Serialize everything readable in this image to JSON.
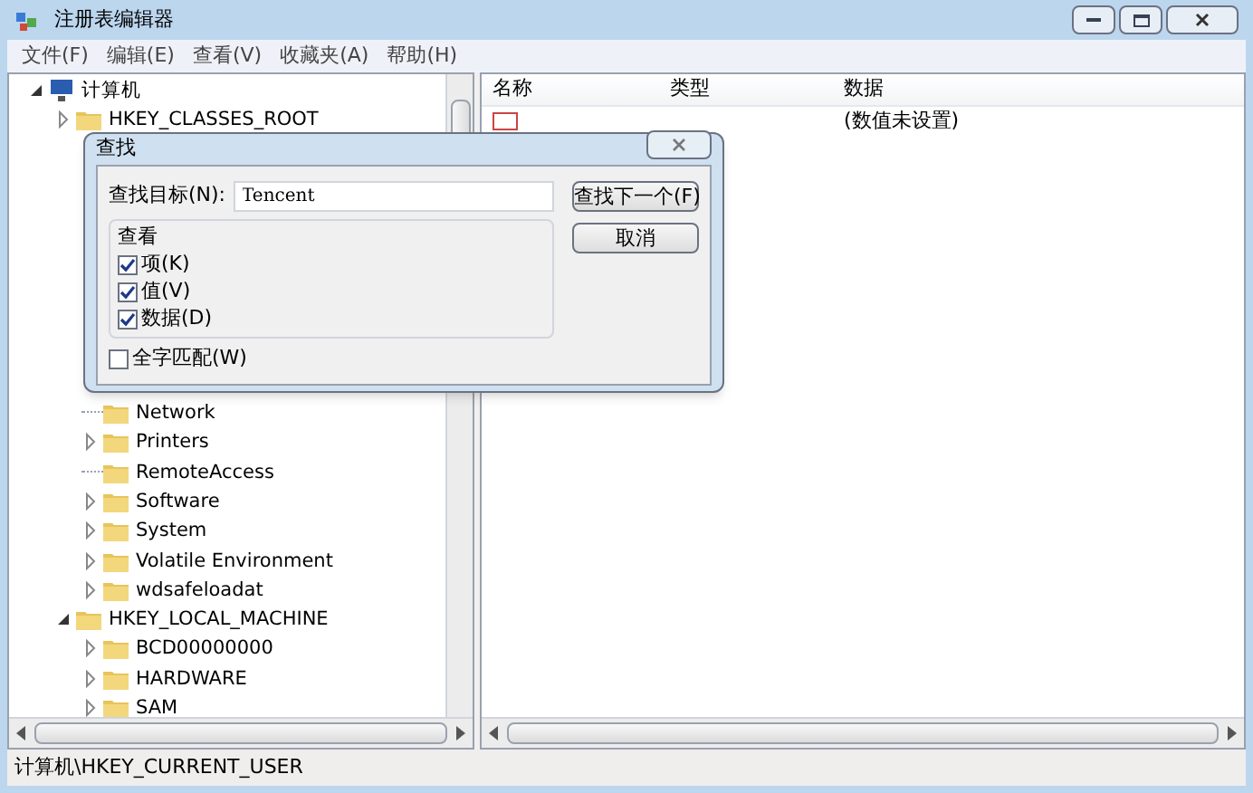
{
  "window": {
    "title": "注册表编辑器"
  },
  "menu": [
    "文件(F)",
    "编辑(E)",
    "查看(V)",
    "收藏夹(A)",
    "帮助(H)"
  ],
  "tree": {
    "label": "计算机",
    "expandable": true,
    "expanded": true,
    "children": [
      {
        "label": "HKEY_CLASSES_ROOT",
        "expandable": true,
        "expanded": false
      },
      {
        "children": [
          {
            "label": "Network",
            "expandable": false
          },
          {
            "label": "Printers",
            "expandable": true,
            "expanded": false
          },
          {
            "label": "RemoteAccess",
            "expandable": false
          },
          {
            "label": "Software",
            "expandable": true,
            "expanded": false
          },
          {
            "label": "System",
            "expandable": true,
            "expanded": false
          },
          {
            "label": "Volatile Environment",
            "expandable": true,
            "expanded": false
          },
          {
            "label": "wdsafeloadat",
            "expandable": true,
            "expanded": false
          }
        ]
      },
      {
        "label": "HKEY_LOCAL_MACHINE",
        "expandable": true,
        "expanded": true,
        "children": [
          {
            "label": "BCD00000000",
            "expandable": true,
            "expanded": false
          },
          {
            "label": "HARDWARE",
            "expandable": true,
            "expanded": false
          },
          {
            "label": "SAM",
            "expandable": true,
            "expanded": false
          }
        ]
      }
    ]
  },
  "list": {
    "columns": [
      "名称",
      "类型",
      "数据"
    ],
    "rows": [
      {
        "data": "(数值未设置)"
      }
    ]
  },
  "dialog": {
    "title": "查找",
    "target_label": "查找目标(N):",
    "target_value": "Tencent",
    "group_title": "查看",
    "options": [
      {
        "label": "项(K)",
        "checked": true
      },
      {
        "label": "值(V)",
        "checked": true
      },
      {
        "label": "数据(D)",
        "checked": true
      }
    ],
    "whole_word": {
      "label": "全字匹配(W)",
      "checked": false
    },
    "buttons": [
      "查找下一个(F)",
      "取消"
    ]
  },
  "status_bar": "计算机\\HKEY_CURRENT_USER"
}
